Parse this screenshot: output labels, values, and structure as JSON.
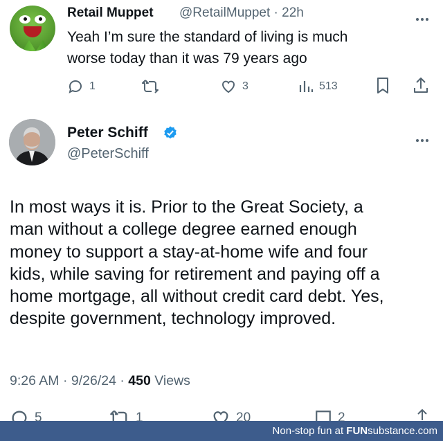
{
  "reply_tweet": {
    "author_name": "Retail Muppet",
    "author_handle": "@RetailMuppet",
    "separator": "·",
    "time_ago": "22h",
    "text_line1": "Yeah I’m sure the standard of living is much",
    "text_line2": "worse today than it was 79 years ago",
    "replies": "1",
    "likes": "3",
    "views": "513",
    "icons": [
      "reply-icon",
      "retweet-icon",
      "like-icon",
      "views-icon",
      "bookmark-icon",
      "share-icon",
      "more-icon"
    ]
  },
  "main_tweet": {
    "author_name": "Peter Schiff",
    "author_handle": "@PeterSchiff",
    "verified_color": "#1d9bf0",
    "lines": [
      "In most ways it is. Prior to the Great Society, a",
      "man without a college degree earned enough",
      "money to support a stay-at-home wife and four",
      "kids, while saving for retirement and paying off a",
      "home mortgage, all without credit card debt. Yes,",
      "despite government, technology improved."
    ],
    "time": "9:26 AM",
    "date": "9/26/24",
    "separator": "·",
    "views_count": "450",
    "views_label": "Views",
    "replies": "5",
    "retweets": "1",
    "likes": "20",
    "bookmarks": "2"
  },
  "watermark": {
    "prefix": "Non-stop fun at ",
    "brand_bold": "FUN",
    "brand_rest": "substance.com",
    "bar_color": "#3d5c8c"
  }
}
